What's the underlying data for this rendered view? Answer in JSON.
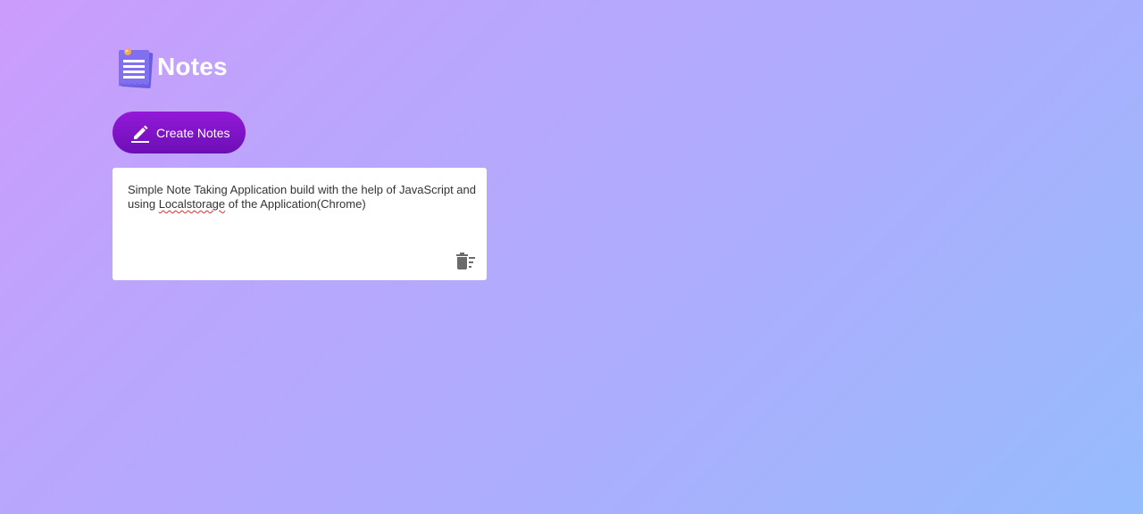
{
  "header": {
    "title": "Notes",
    "logo_icon": "notepad-icon"
  },
  "toolbar": {
    "create_label": "Create Notes",
    "create_icon": "pen-icon"
  },
  "notes": [
    {
      "text_before": "Simple Note Taking Application build with the help of JavaScript and using ",
      "misspelled": "Localstorage",
      "text_after": " of the Application(Chrome)",
      "delete_icon": "delete-sweep-icon"
    }
  ],
  "colors": {
    "background_start": "#cc9cfd",
    "background_end": "#96bcfc",
    "button_start": "#9419d8",
    "button_end": "#6c0fb6",
    "logo_purple": "#7d6cf0",
    "card": "#ffffff"
  }
}
